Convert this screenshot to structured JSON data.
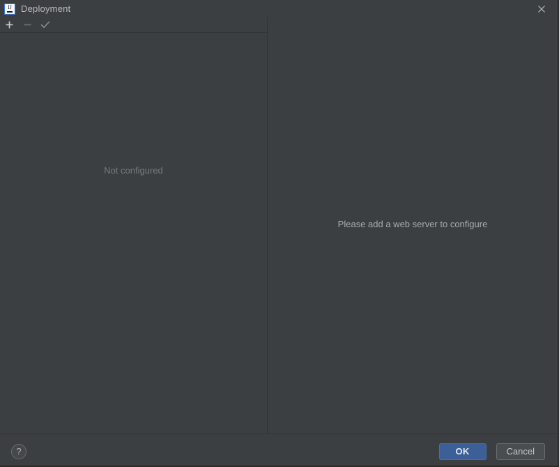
{
  "window": {
    "title": "Deployment",
    "app_icon": "intellij-idea-icon",
    "close_icon": "close-icon"
  },
  "toolbar": {
    "buttons": [
      {
        "name": "add-server-button",
        "icon": "plus-icon",
        "label": "Add",
        "enabled": true
      },
      {
        "name": "remove-server-button",
        "icon": "minus-icon",
        "label": "Remove",
        "enabled": false
      },
      {
        "name": "set-default-server-button",
        "icon": "check-icon",
        "label": "Use as Default",
        "enabled": true
      }
    ]
  },
  "server_list": {
    "empty_text": "Not configured",
    "items": []
  },
  "detail": {
    "message": "Please add a web server to configure"
  },
  "footer": {
    "help_label": "?",
    "ok_label": "OK",
    "cancel_label": "Cancel"
  },
  "colors": {
    "background": "#3c3f41",
    "divider": "#323232",
    "primary_button": "#3b5f96",
    "text": "#bbbbbb",
    "muted_text": "#777a7c",
    "accent": "#3b7ddd"
  }
}
